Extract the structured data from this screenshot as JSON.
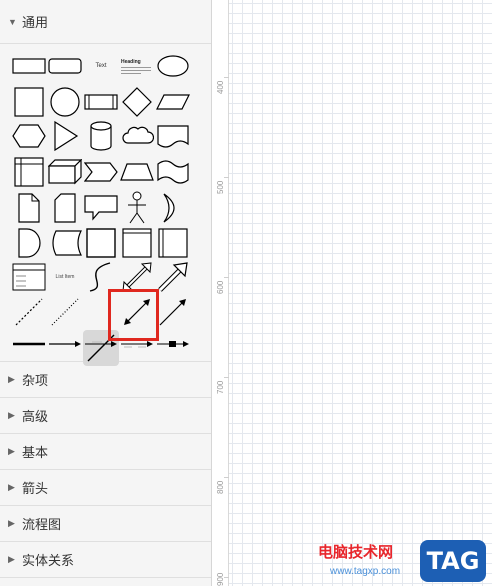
{
  "sidebar": {
    "open_section": {
      "label": "通用",
      "caret": "▼"
    },
    "collapsed_sections": [
      {
        "label": "杂项",
        "caret": "▶"
      },
      {
        "label": "高级",
        "caret": "▶"
      },
      {
        "label": "基本",
        "caret": "▶"
      },
      {
        "label": "箭头",
        "caret": "▶"
      },
      {
        "label": "流程图",
        "caret": "▶"
      },
      {
        "label": "实体关系",
        "caret": "▶"
      }
    ],
    "shape_text": {
      "text_sample": "Text",
      "heading_sample": "Heading",
      "list_sample": "List Item"
    }
  },
  "canvas": {
    "ruler_labels": [
      "400",
      "500",
      "600",
      "700",
      "800",
      "900"
    ]
  },
  "watermark": {
    "site_name": "电脑技术网",
    "url": "www.tagxp.com",
    "logo": "TAG"
  },
  "colors": {
    "highlight": "#e0281f",
    "grid": "#e4e8ee",
    "panel_bg": "#f5f5f5"
  }
}
